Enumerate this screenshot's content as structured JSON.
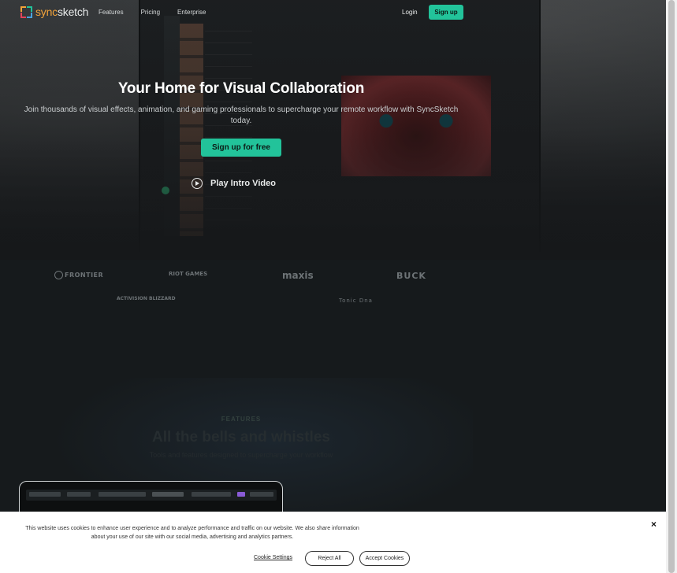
{
  "nav": {
    "logo_part1": "sync",
    "logo_part2": "sketch",
    "links": [
      "Features",
      "Pricing",
      "Enterprise"
    ],
    "login": "Login",
    "signup": "Sign up"
  },
  "hero": {
    "title": "Your Home for Visual Collaboration",
    "subtitle": "Join thousands of visual effects, animation, and gaming professionals to supercharge your remote workflow with SyncSketch today.",
    "cta": "Sign up for free",
    "play_video": "Play Intro Video"
  },
  "clients": [
    "FRONTIER",
    "RIOT GAMES",
    "maxis",
    "BUCK",
    "ACTIVISION BLIZZARD",
    "Tonic Dna"
  ],
  "features": {
    "eyebrow": "FEATURES",
    "title": "All the bells and whistles",
    "subtitle": "Tools and features designed to supercharge your workflow"
  },
  "cookie": {
    "text": "This website uses cookies to enhance user experience and to analyze performance and traffic on our website. We also share information about your use of our site with our social media, advertising and analytics partners.",
    "settings": "Cookie Settings",
    "reject": "Reject All",
    "accept": "Accept Cookies",
    "close": "×"
  },
  "colors": {
    "accent": "#22c39a",
    "logo_orange": "#f2a33a",
    "background": "#161a1c"
  }
}
